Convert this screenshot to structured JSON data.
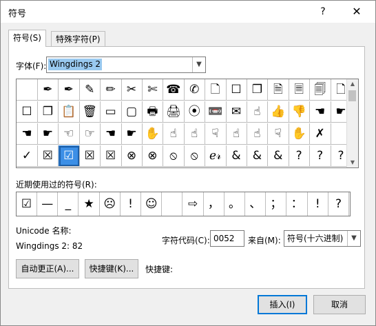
{
  "window": {
    "title": "符号",
    "help_label": "?",
    "close_label": "✕"
  },
  "tabs": [
    {
      "label": "符号(S)"
    },
    {
      "label": "特殊字符(P)"
    }
  ],
  "font": {
    "label": "字体(F):",
    "value": "Wingdings 2"
  },
  "grid": {
    "rows": [
      [
        "",
        "✒",
        "✒",
        "✎",
        "✏",
        "✂",
        "✄",
        "☎",
        "✆",
        "🗋",
        "☐",
        "❐",
        "🗎",
        "🗏",
        "🗐",
        "🗋"
      ],
      [
        "☐",
        "❐",
        "📋",
        "🗑",
        "▭",
        "▢",
        "🖶",
        "🖨",
        "⦿",
        "📼",
        "✉",
        "☝",
        "👍",
        "👎",
        "☚",
        "☛"
      ],
      [
        "☚",
        "☛",
        "☜",
        "☞",
        "☚",
        "☛",
        "✋",
        "☝",
        "☝",
        "☟",
        "☝",
        "☝",
        "☟",
        "✋",
        "✗",
        ""
      ],
      [
        "✓",
        "☒",
        "☑",
        "☒",
        "☒",
        "⊗",
        "⊗",
        "⦸",
        "⦸",
        "ℯ𝓇",
        "&",
        "&",
        "&",
        "?",
        "?",
        "?"
      ]
    ],
    "selected_row": 3,
    "selected_col": 2
  },
  "recent": {
    "label": "近期使用过的符号(R):",
    "items": [
      "☑",
      "—",
      "_",
      "★",
      "☹",
      "!",
      "☺",
      "",
      "⇨",
      "，",
      "。",
      "、",
      "；",
      "：",
      "!",
      "?"
    ]
  },
  "unicode": {
    "name_label": "Unicode 名称:",
    "value": "Wingdings 2: 82"
  },
  "char_code": {
    "label": "字符代码(C):",
    "value": "0052"
  },
  "from": {
    "label": "来自(M):",
    "value": "符号(十六进制)"
  },
  "buttons": {
    "autocorrect": "自动更正(A)...",
    "shortcut_key": "快捷键(K)...",
    "shortcut_label": "快捷键:",
    "insert": "插入(I)",
    "cancel": "取消"
  }
}
